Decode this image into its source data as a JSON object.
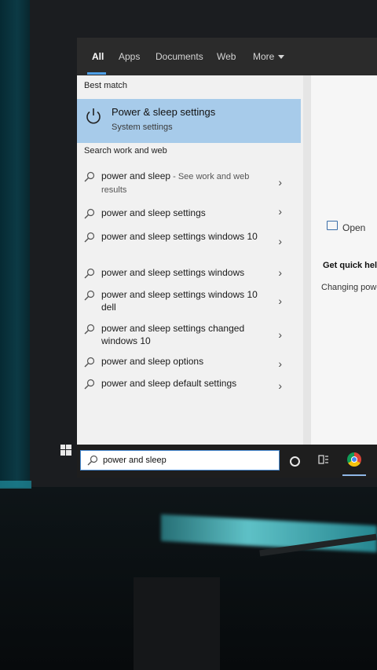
{
  "tabs": [
    {
      "label": "All",
      "active": true
    },
    {
      "label": "Apps"
    },
    {
      "label": "Documents"
    },
    {
      "label": "Web"
    },
    {
      "label": "More"
    }
  ],
  "best_match": {
    "heading": "Best match",
    "title": "Power & sleep settings",
    "subtitle": "System settings",
    "icon": "power-icon"
  },
  "web_section": {
    "heading": "Search work and web",
    "results": [
      {
        "text": "power and sleep",
        "suffix": " - See work and web results"
      },
      {
        "text": "power and sleep settings"
      },
      {
        "text": "power and sleep settings windows 10"
      },
      {
        "text": "power and sleep settings windows"
      },
      {
        "text": "power and sleep settings windows 10 dell"
      },
      {
        "text": "power and sleep settings changed windows 10"
      },
      {
        "text": "power and sleep options"
      },
      {
        "text": "power and sleep default settings"
      }
    ]
  },
  "preview": {
    "open_label": "Open",
    "help_title": "Get quick help f",
    "help_link": "Changing power"
  },
  "taskbar": {
    "search_value": "power and sleep",
    "icons": [
      "windows-start-icon",
      "search-icon",
      "cortana-icon",
      "task-view-icon",
      "chrome-icon"
    ]
  },
  "colors": {
    "accent": "#4ea0e8",
    "selected_row": "#a7cbea",
    "tab_bar": "#2b2b2b"
  }
}
